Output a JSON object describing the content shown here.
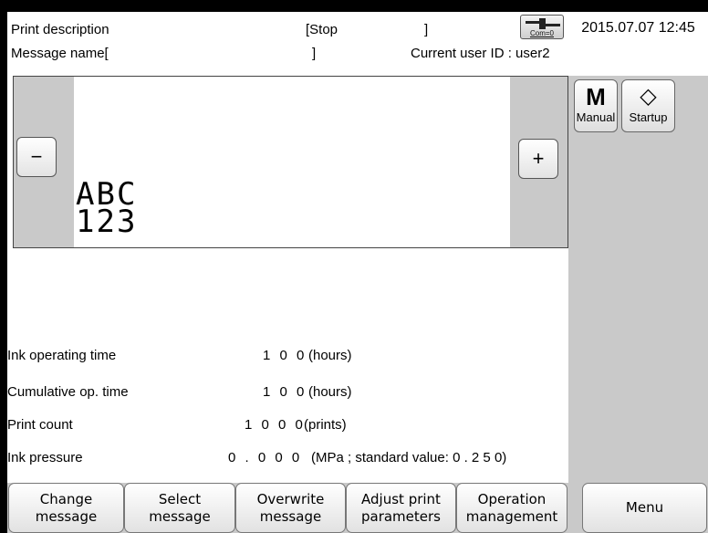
{
  "header": {
    "title": "Print description",
    "status": "[Stop",
    "status_close": "]",
    "com_label": "Com=0",
    "datetime": "2015.07.07 12:45",
    "message_name_label": "Message name[",
    "message_name_close": "]",
    "user_label": "Current user ID : user2"
  },
  "right_panel": {
    "manual": {
      "glyph": "M",
      "label": "Manual"
    },
    "startup": {
      "glyph": "◇",
      "label": "Startup"
    }
  },
  "preview": {
    "minus": "−",
    "plus": "+",
    "line1": "ABC",
    "line2": "123"
  },
  "stats": {
    "ink_time": {
      "label": "Ink operating time",
      "value": "1 0 0",
      "unit": "(hours)"
    },
    "cumulative": {
      "label": "Cumulative op. time",
      "value": "1 0 0",
      "unit": "(hours)"
    },
    "print_count": {
      "label": "Print count",
      "value": "1 0 0 0",
      "unit": "(prints)"
    },
    "ink_pressure": {
      "label": "Ink pressure",
      "value": "0 .  0 0 0",
      "unit": "(MPa ; standard value: 0 .  2 5 0)"
    }
  },
  "footer": {
    "change": "Change\nmessage",
    "select": "Select\nmessage",
    "overwrite": "Overwrite\nmessage",
    "adjust": "Adjust print\nparameters",
    "operation": "Operation\nmanagement",
    "menu": "Menu"
  }
}
